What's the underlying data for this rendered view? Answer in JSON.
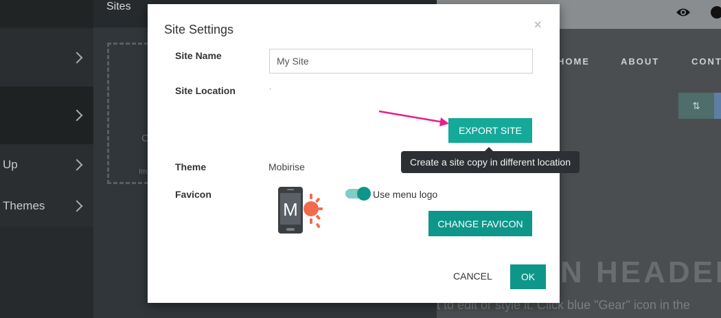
{
  "sidebar": {
    "items": [
      {
        "label": ""
      },
      {
        "label": ""
      },
      {
        "label": "Up"
      },
      {
        "label": "Themes"
      }
    ]
  },
  "sites_panel": {
    "title": "Sites",
    "ghost_c": "C",
    "ghost_im": "Im"
  },
  "preview": {
    "nav": [
      "HOME",
      "ABOUT",
      "CONT"
    ],
    "big_header": "N HEADER",
    "sub_text": "t to edit or style it. Click blue \"Gear\" icon in the",
    "sort_icon": "⇅"
  },
  "dialog": {
    "title": "Site Settings",
    "close": "×",
    "site_name_label": "Site Name",
    "site_name_value": "My Site",
    "site_location_label": "Site Location",
    "site_location_value": "·",
    "export_button": "EXPORT SITE",
    "export_tooltip": "Create a site copy in different location",
    "theme_label": "Theme",
    "theme_value": "Mobirise",
    "favicon_label": "Favicon",
    "favicon_letter": "M",
    "use_menu_logo_label": "Use menu logo",
    "use_menu_logo_on": true,
    "change_favicon_button": "CHANGE FAVICON",
    "cancel_button": "CANCEL",
    "ok_button": "OK"
  },
  "colors": {
    "accent": "#15a99a",
    "accent_dark": "#0e968a",
    "annotation_arrow": "#e91e8c",
    "tooltip_bg": "#2c2f33",
    "logo_sun": "#f26b4f"
  }
}
